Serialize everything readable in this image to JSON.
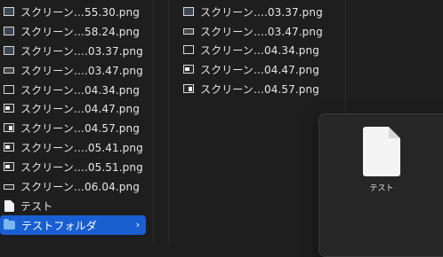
{
  "column1": {
    "items": [
      {
        "label": "スクリーン…55.30.png",
        "icon": "image-thumbnail-icon"
      },
      {
        "label": "スクリーン…58.24.png",
        "icon": "image-thumbnail-icon"
      },
      {
        "label": "スクリーン….03.37.png",
        "icon": "image-thumbnail-icon"
      },
      {
        "label": "スクリーン….03.47.png",
        "icon": "image-thumbnail-icon"
      },
      {
        "label": "スクリーン…04.34.png",
        "icon": "image-thumbnail-icon"
      },
      {
        "label": "スクリーン…04.47.png",
        "icon": "image-thumbnail-icon"
      },
      {
        "label": "スクリーン…04.57.png",
        "icon": "image-thumbnail-icon"
      },
      {
        "label": "スクリーン….05.41.png",
        "icon": "image-thumbnail-icon"
      },
      {
        "label": "スクリーン….05.51.png",
        "icon": "image-thumbnail-icon"
      },
      {
        "label": "スクリーン…06.04.png",
        "icon": "image-thumbnail-icon"
      },
      {
        "label": "テスト",
        "icon": "document-icon"
      },
      {
        "label": "テストフォルダ",
        "icon": "folder-icon",
        "selected": true
      }
    ]
  },
  "column2": {
    "items": [
      {
        "label": "スクリーン….03.37.png",
        "icon": "image-thumbnail-icon"
      },
      {
        "label": "スクリーン….03.47.png",
        "icon": "image-thumbnail-icon"
      },
      {
        "label": "スクリーン…04.34.png",
        "icon": "image-thumbnail-icon"
      },
      {
        "label": "スクリーン…04.47.png",
        "icon": "image-thumbnail-icon"
      },
      {
        "label": "スクリーン…04.57.png",
        "icon": "image-thumbnail-icon"
      }
    ]
  },
  "preview": {
    "label": "テスト",
    "icon": "document-icon"
  },
  "colors": {
    "selection": "#1a5fd1",
    "background": "#1e1e1e",
    "folder": "#7ab6f2"
  }
}
